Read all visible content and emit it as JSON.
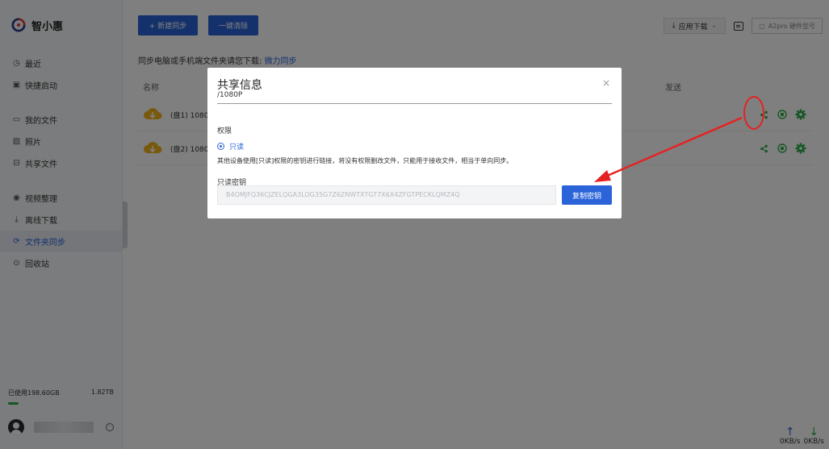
{
  "app": {
    "name": "智小惠"
  },
  "sidebar": {
    "items": [
      {
        "label": "最近",
        "icon": "clock-icon"
      },
      {
        "label": "快捷启动",
        "icon": "launch-icon"
      },
      {
        "label": "我的文件",
        "icon": "folder-icon"
      },
      {
        "label": "照片",
        "icon": "image-icon"
      },
      {
        "label": "共享文件",
        "icon": "share-folder-icon"
      },
      {
        "label": "视频整理",
        "icon": "play-icon"
      },
      {
        "label": "离线下载",
        "icon": "download-icon"
      },
      {
        "label": "文件夹同步",
        "icon": "sync-icon",
        "active": true
      },
      {
        "label": "回收站",
        "icon": "trash-icon"
      }
    ],
    "storage": {
      "used": "已使用198.60GB",
      "total": "1.82TB",
      "used_fraction": 0.11
    }
  },
  "toolbar": {
    "new_sync": "+ 新建同步",
    "clear": "一键清除",
    "app_download": "应用下载",
    "device": "A2pro 硬件型号"
  },
  "main": {
    "subtitle_text": "同步电脑或手机端文件夹请您下载: ",
    "subtitle_link": "微力同步",
    "col_name": "名称",
    "col_send": "发送",
    "rows": [
      {
        "name": "(盘1) 1080P"
      },
      {
        "name": "(盘2) 1080P"
      }
    ]
  },
  "speed": {
    "up": "0KB/s",
    "down": "0KB/s"
  },
  "modal": {
    "title": "共享信息",
    "close": "×",
    "path": "/1080P",
    "permission_label": "权限",
    "readonly_option": "只读",
    "description": "其他设备使用[只读]权限的密钥进行链接，将没有权限删改文件，只能用于接收文件，相当于单向同步。",
    "key_label": "只读密钥",
    "key_value": "B4OMJFQ36CJZELQGA3LOG35G7Z6ZNWTXTGT7X6X4ZFGTPECKLQMZ4Q",
    "copy_button": "复制密钥"
  },
  "colors": {
    "accent": "#2b63d9",
    "green": "#2fae4b",
    "annotation": "#e52222"
  }
}
